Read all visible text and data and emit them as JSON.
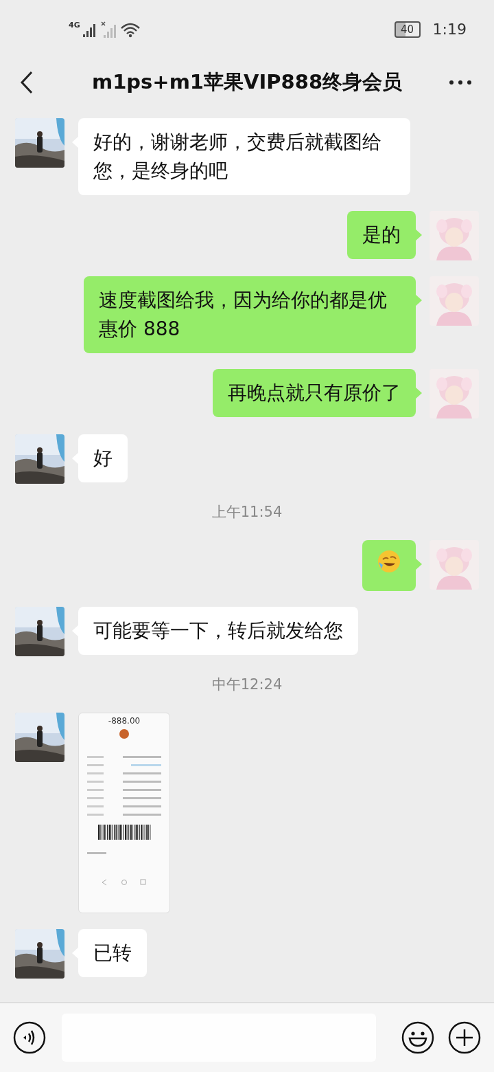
{
  "status_bar": {
    "network": "4G",
    "battery": "40",
    "time": "1:19"
  },
  "header": {
    "title": "m1ps+m1苹果VIP888终身会员"
  },
  "messages": [
    {
      "kind": "text",
      "outgoing": false,
      "text": "好的，谢谢老师，交费后就截图给您，是终身的吧"
    },
    {
      "kind": "text",
      "outgoing": true,
      "text": "是的"
    },
    {
      "kind": "text",
      "outgoing": true,
      "text": "速度截图给我，因为给你的都是优惠价 888"
    },
    {
      "kind": "text",
      "outgoing": true,
      "text": "再晚点就只有原价了"
    },
    {
      "kind": "text",
      "outgoing": false,
      "text": "好"
    },
    {
      "kind": "time",
      "text": "上午11:54"
    },
    {
      "kind": "emoji",
      "outgoing": true
    },
    {
      "kind": "text",
      "outgoing": false,
      "text": "可能要等一下，转后就发给您"
    },
    {
      "kind": "time",
      "text": "中午12:24"
    },
    {
      "outgoing": false,
      "amount": "-888.00"
    },
    {
      "kind": "text",
      "outgoing": false,
      "text": "已转"
    }
  ]
}
